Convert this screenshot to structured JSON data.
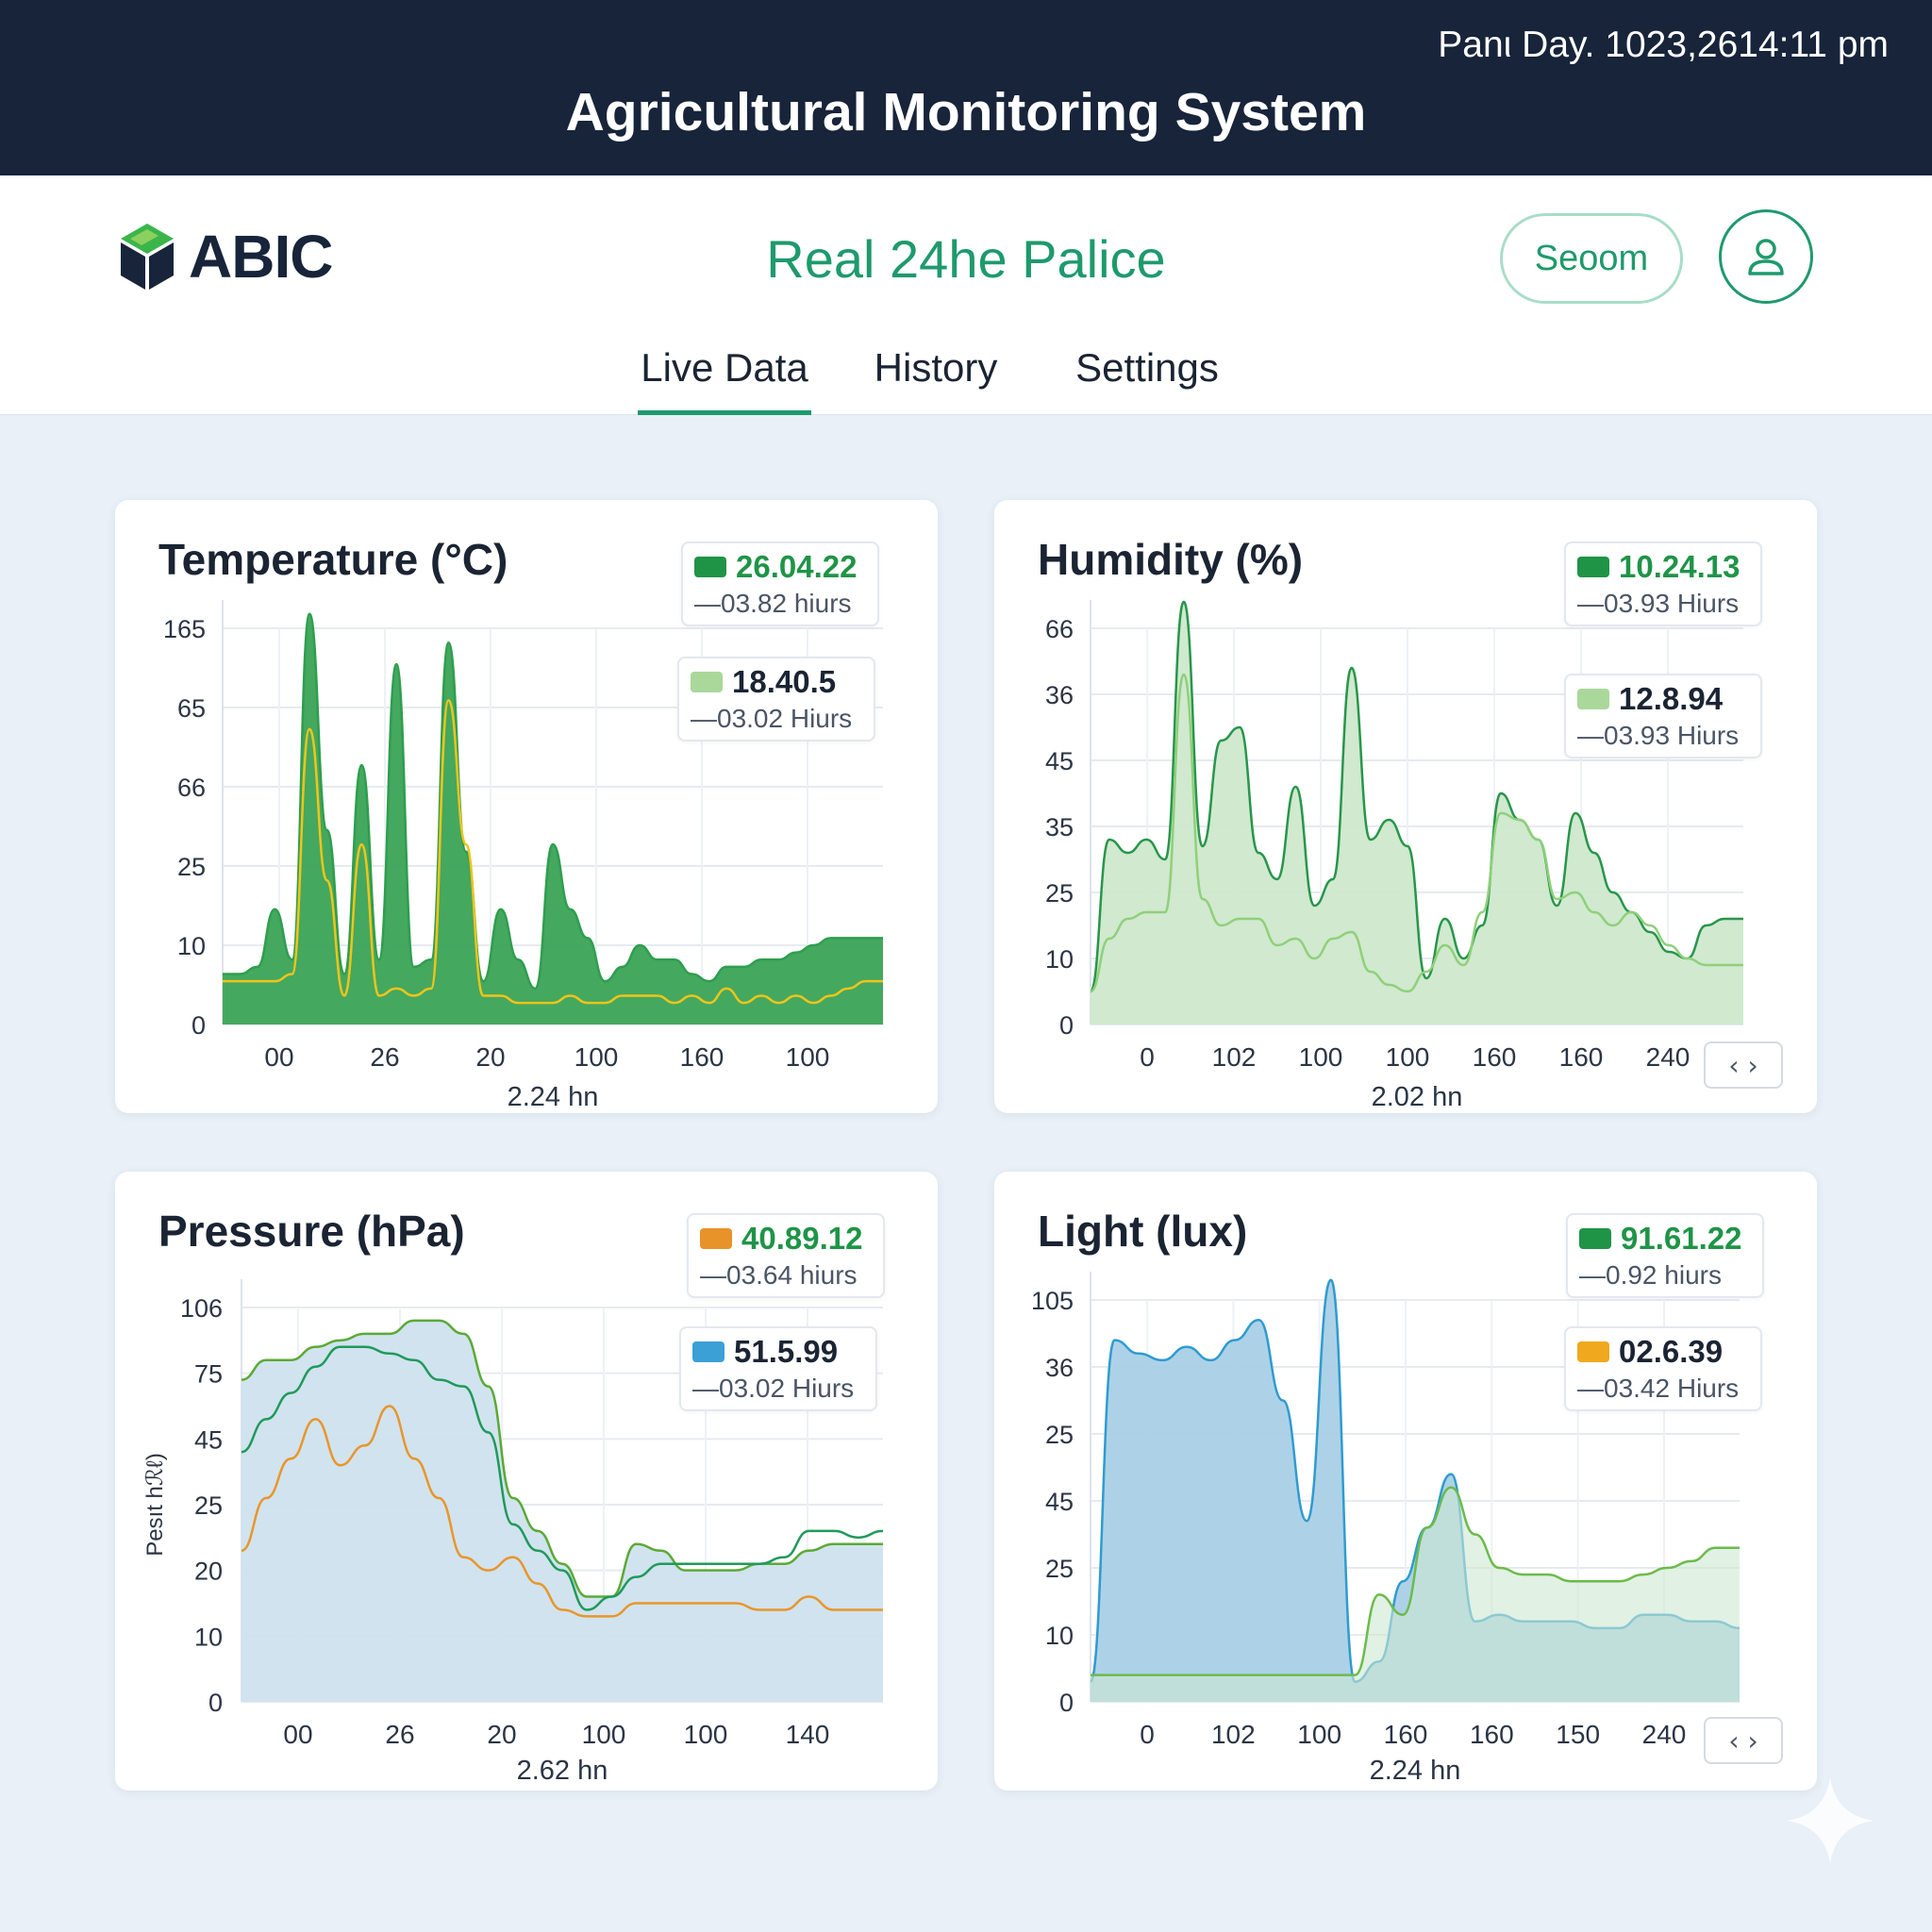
{
  "topbar": {
    "datetime": "Panι Day. 1023,2614:11 pm",
    "title": "Agricultural Monitoring System"
  },
  "header": {
    "logo_text": "ABIC",
    "center_title": "Real 24he Palice",
    "search_label": "Seoom",
    "tabs": [
      {
        "label": "Live Data",
        "active": true
      },
      {
        "label": "History",
        "active": false
      },
      {
        "label": "Settings",
        "active": false
      }
    ]
  },
  "colors": {
    "navy": "#17243a",
    "accent": "#1e9a6c",
    "green_dark": "#1f9447",
    "green_light": "#9fd59c",
    "yellow": "#f0a81e",
    "orange": "#e8922a",
    "blue": "#3aa0d6"
  },
  "icons": [
    "logo-cube-icon",
    "user-icon",
    "chevron-left-icon",
    "chevron-right-icon",
    "sparkle-icon"
  ],
  "chart_data": [
    {
      "type": "area",
      "title": "Temperature (°C)",
      "xlabel": "2.24 hn",
      "ylabel": "",
      "y_tick_labels": [
        "0",
        "10",
        "25",
        "66",
        "65",
        "165"
      ],
      "x_tick_labels": [
        "00",
        "26",
        "20",
        "100",
        "160",
        "100"
      ],
      "grid": true,
      "legend": [
        {
          "value": "26.04.22",
          "sub": "03.82 hiurs",
          "color": "#1f9447",
          "value_color": "#1f9447"
        },
        {
          "value": "18.40.5",
          "sub": "03.02 Hiurs",
          "color": "#a9d89a",
          "value_color": "#1b2433"
        }
      ],
      "ylim": [
        0,
        5.5
      ],
      "series": [
        {
          "color": "#2e9e4f",
          "fill": "#3aa356",
          "values": [
            0.7,
            0.7,
            0.8,
            1.6,
            0.9,
            5.7,
            2.7,
            0.7,
            3.6,
            0.9,
            5.0,
            0.8,
            0.9,
            5.3,
            2.4,
            0.6,
            1.6,
            0.9,
            0.5,
            2.5,
            1.6,
            1.2,
            0.6,
            0.8,
            1.1,
            0.9,
            0.9,
            0.7,
            0.6,
            0.8,
            0.8,
            0.9,
            0.9,
            1.0,
            1.1,
            1.2,
            1.2,
            1.2,
            1.2
          ]
        },
        {
          "color": "#f0c419",
          "fill": "none",
          "values": [
            0.6,
            0.6,
            0.6,
            0.6,
            0.7,
            4.1,
            2.0,
            0.4,
            2.5,
            0.4,
            0.5,
            0.4,
            0.5,
            4.5,
            2.5,
            0.4,
            0.4,
            0.3,
            0.3,
            0.3,
            0.4,
            0.3,
            0.3,
            0.4,
            0.4,
            0.4,
            0.3,
            0.4,
            0.3,
            0.5,
            0.3,
            0.4,
            0.3,
            0.4,
            0.3,
            0.4,
            0.5,
            0.6,
            0.6
          ]
        }
      ]
    },
    {
      "type": "area",
      "title": "Humidity (%)",
      "xlabel": "2.02 hn",
      "ylabel": "",
      "y_tick_labels": [
        "0",
        "10",
        "25",
        "35",
        "45",
        "36",
        "66"
      ],
      "x_tick_labels": [
        "0",
        "102",
        "100",
        "100",
        "160",
        "160",
        "240"
      ],
      "grid": true,
      "legend": [
        {
          "value": "10.24.13",
          "sub": "03.93 Hiurs",
          "color": "#1f9447",
          "value_color": "#1f9447"
        },
        {
          "value": "12.8.94",
          "sub": "03.93 Hiurs",
          "color": "#a9d89a",
          "value_color": "#1b2433"
        }
      ],
      "ylim": [
        0,
        6
      ],
      "series": [
        {
          "color": "#27964a",
          "fill": "#cde8cc",
          "values": [
            0.5,
            2.8,
            2.6,
            2.8,
            2.5,
            6.4,
            2.7,
            4.3,
            4.5,
            2.6,
            2.2,
            3.6,
            1.8,
            2.2,
            5.4,
            2.8,
            3.1,
            2.7,
            0.7,
            1.6,
            1.0,
            1.5,
            3.5,
            3.1,
            2.8,
            1.8,
            3.2,
            2.6,
            2.0,
            1.7,
            1.4,
            1.1,
            1.0,
            1.5,
            1.6,
            1.6
          ]
        },
        {
          "color": "#8fd07a",
          "fill": "none",
          "values": [
            0.5,
            1.3,
            1.6,
            1.7,
            1.7,
            5.3,
            1.9,
            1.5,
            1.6,
            1.6,
            1.2,
            1.3,
            1.0,
            1.3,
            1.4,
            0.8,
            0.6,
            0.5,
            0.8,
            1.2,
            0.9,
            1.7,
            3.2,
            3.1,
            2.8,
            1.9,
            2.0,
            1.7,
            1.5,
            1.7,
            1.5,
            1.2,
            1.0,
            0.9,
            0.9,
            0.9
          ]
        }
      ]
    },
    {
      "type": "line",
      "title": "Pressure (hPa)",
      "xlabel": "2.62 hn",
      "ylabel": "Pesıt hℛℓ)",
      "y_tick_labels": [
        "0",
        "10",
        "20",
        "25",
        "45",
        "75",
        "106"
      ],
      "x_tick_labels": [
        "00",
        "26",
        "20",
        "100",
        "100",
        "140"
      ],
      "grid": true,
      "legend": [
        {
          "value": "40.89.12",
          "sub": "03.64 hiurs",
          "color": "#e8922a",
          "value_color": "#1f9447"
        },
        {
          "value": "51.5.99",
          "sub": "03.02 Hiurs",
          "color": "#3aa0d6",
          "value_color": "#1b2433"
        }
      ],
      "ylim": [
        0,
        6
      ],
      "series": [
        {
          "color": "#5aaa35",
          "fill": "#cfe1ee",
          "values": [
            4.9,
            5.2,
            5.2,
            5.4,
            5.5,
            5.6,
            5.6,
            5.8,
            5.8,
            5.6,
            4.8,
            3.1,
            2.6,
            2.1,
            1.6,
            1.6,
            2.4,
            2.3,
            2.0,
            2.0,
            2.0,
            2.1,
            2.1,
            2.3,
            2.4,
            2.4,
            2.4
          ]
        },
        {
          "color": "#1f9a5a",
          "fill": "none",
          "values": [
            3.8,
            4.3,
            4.7,
            5.1,
            5.4,
            5.4,
            5.3,
            5.2,
            4.9,
            4.8,
            4.1,
            2.7,
            2.3,
            2.0,
            1.4,
            1.6,
            1.9,
            2.1,
            2.1,
            2.1,
            2.1,
            2.1,
            2.2,
            2.6,
            2.6,
            2.5,
            2.6
          ]
        },
        {
          "color": "#e8962a",
          "fill": "none",
          "values": [
            2.3,
            3.1,
            3.7,
            4.3,
            3.6,
            3.9,
            4.5,
            3.7,
            3.1,
            2.2,
            2.0,
            2.2,
            1.8,
            1.4,
            1.3,
            1.3,
            1.5,
            1.5,
            1.5,
            1.5,
            1.5,
            1.4,
            1.4,
            1.6,
            1.4,
            1.4,
            1.4
          ]
        }
      ]
    },
    {
      "type": "area",
      "title": "Light (lux)",
      "xlabel": "2.24 hn",
      "ylabel": "",
      "y_tick_labels": [
        "0",
        "10",
        "25",
        "45",
        "25",
        "36",
        "105"
      ],
      "x_tick_labels": [
        "0",
        "102",
        "100",
        "160",
        "160",
        "150",
        "240"
      ],
      "grid": true,
      "legend": [
        {
          "value": "91.61.22",
          "sub": "0.92 hiurs",
          "color": "#1f9447",
          "value_color": "#1f9447"
        },
        {
          "value": "02.6.39",
          "sub": "03.42 Hiurs",
          "color": "#f0a81e",
          "value_color": "#1b2433"
        }
      ],
      "ylim": [
        0,
        6
      ],
      "series": [
        {
          "color": "#2f9bd0",
          "fill": "#a9d0e6",
          "values": [
            0.3,
            5.4,
            5.2,
            5.1,
            5.3,
            5.1,
            5.4,
            5.7,
            4.5,
            2.7,
            6.3,
            0.3,
            0.6,
            1.8,
            2.6,
            3.4,
            1.2,
            1.3,
            1.2,
            1.2,
            1.2,
            1.1,
            1.1,
            1.3,
            1.3,
            1.2,
            1.2,
            1.1
          ]
        },
        {
          "color": "#6cbb4a",
          "fill": "#cde8d2",
          "values": [
            0.4,
            0.4,
            0.4,
            0.4,
            0.4,
            0.4,
            0.4,
            0.4,
            0.4,
            0.4,
            0.4,
            0.4,
            1.6,
            1.3,
            2.6,
            3.2,
            2.5,
            2.0,
            1.9,
            1.9,
            1.8,
            1.8,
            1.8,
            1.9,
            2.0,
            2.1,
            2.3,
            2.3
          ]
        }
      ]
    }
  ]
}
